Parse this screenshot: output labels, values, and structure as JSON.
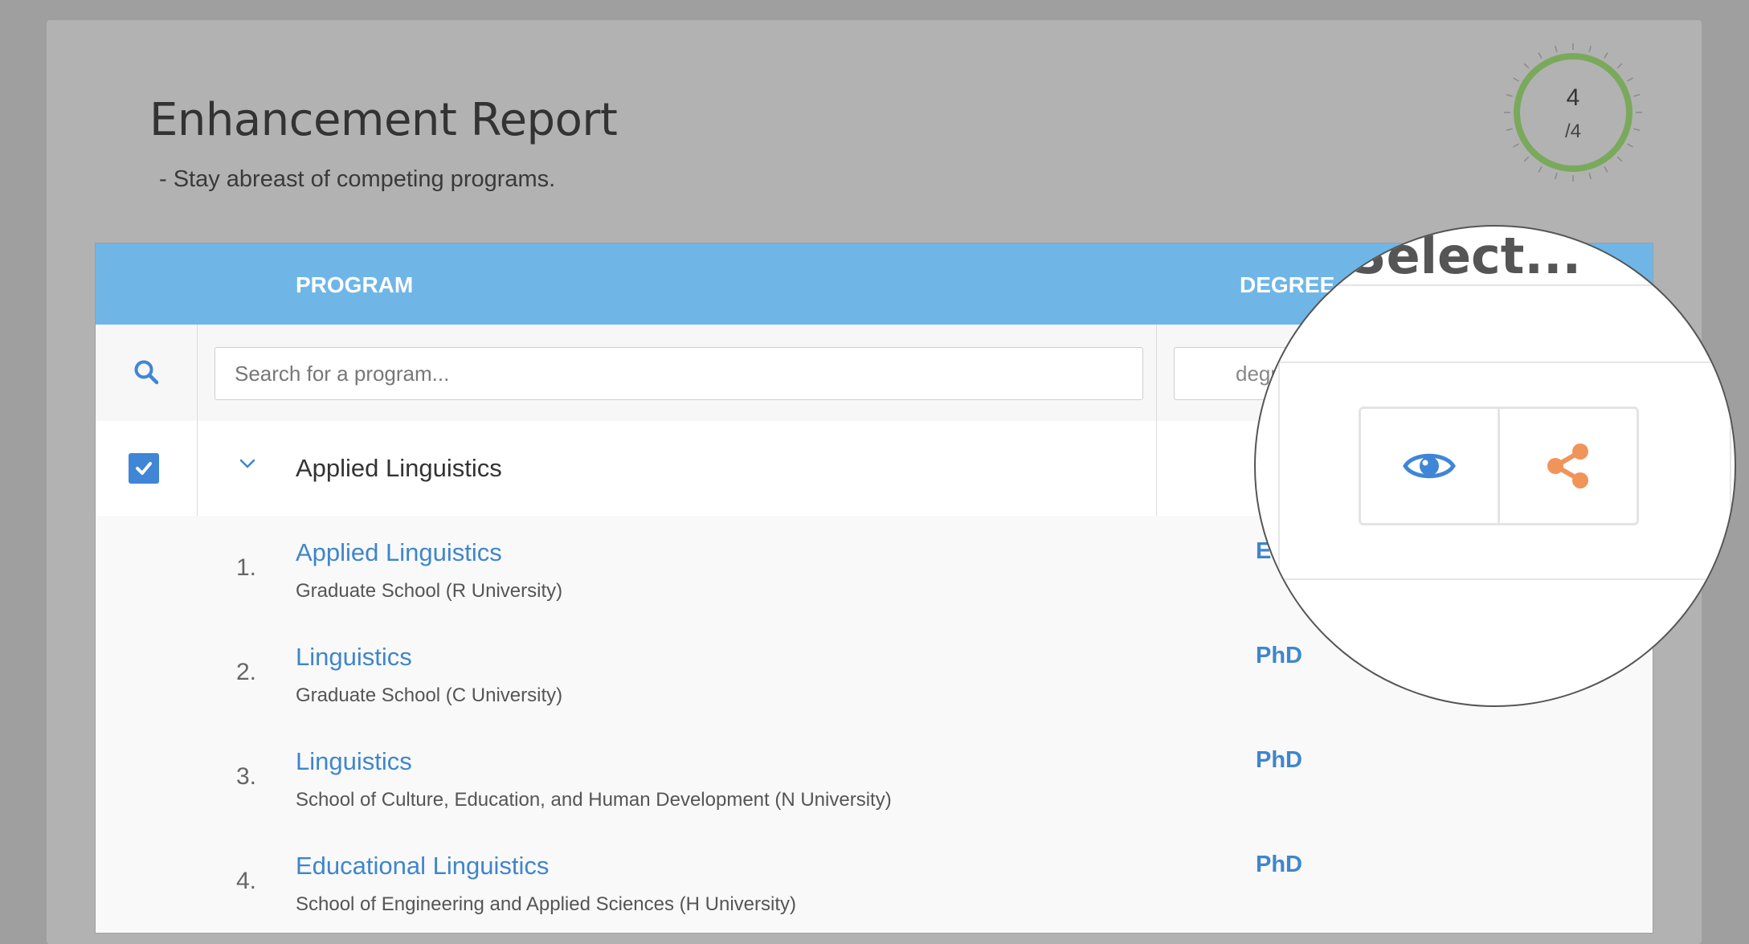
{
  "header": {
    "title": "Enhancement Report",
    "subtitle": "- Stay abreast of competing programs."
  },
  "progress": {
    "current": "4",
    "total": "/4",
    "fraction": 1.0,
    "color": "#7aa95c"
  },
  "table": {
    "columns": {
      "program": "PROGRAM",
      "degree": "DEGREE"
    },
    "search": {
      "program_placeholder": "Search for a program...",
      "degree_placeholder": "degree"
    },
    "group": {
      "label": "Applied Linguistics",
      "checked": true
    },
    "rows": [
      {
        "num": "1.",
        "name": "Applied Linguistics",
        "school": "Graduate School (R University)",
        "degree": "Ed"
      },
      {
        "num": "2.",
        "name": "Linguistics",
        "school": "Graduate School (C University)",
        "degree": "PhD"
      },
      {
        "num": "3.",
        "name": "Linguistics",
        "school": "School of Culture, Education, and Human Development (N University)",
        "degree": "PhD"
      },
      {
        "num": "4.",
        "name": "Educational Linguistics",
        "school": "School of Engineering and Applied Sciences (H University)",
        "degree": "PhD"
      }
    ]
  },
  "magnifier": {
    "select_text": "Select...",
    "actions": [
      {
        "icon": "eye-icon",
        "color": "#3f86d6"
      },
      {
        "icon": "share-icon",
        "color": "#f0945a"
      }
    ]
  },
  "colors": {
    "header_bg": "#6fb6e7",
    "link": "#3e86cc",
    "checkbox": "#3f86d6"
  }
}
